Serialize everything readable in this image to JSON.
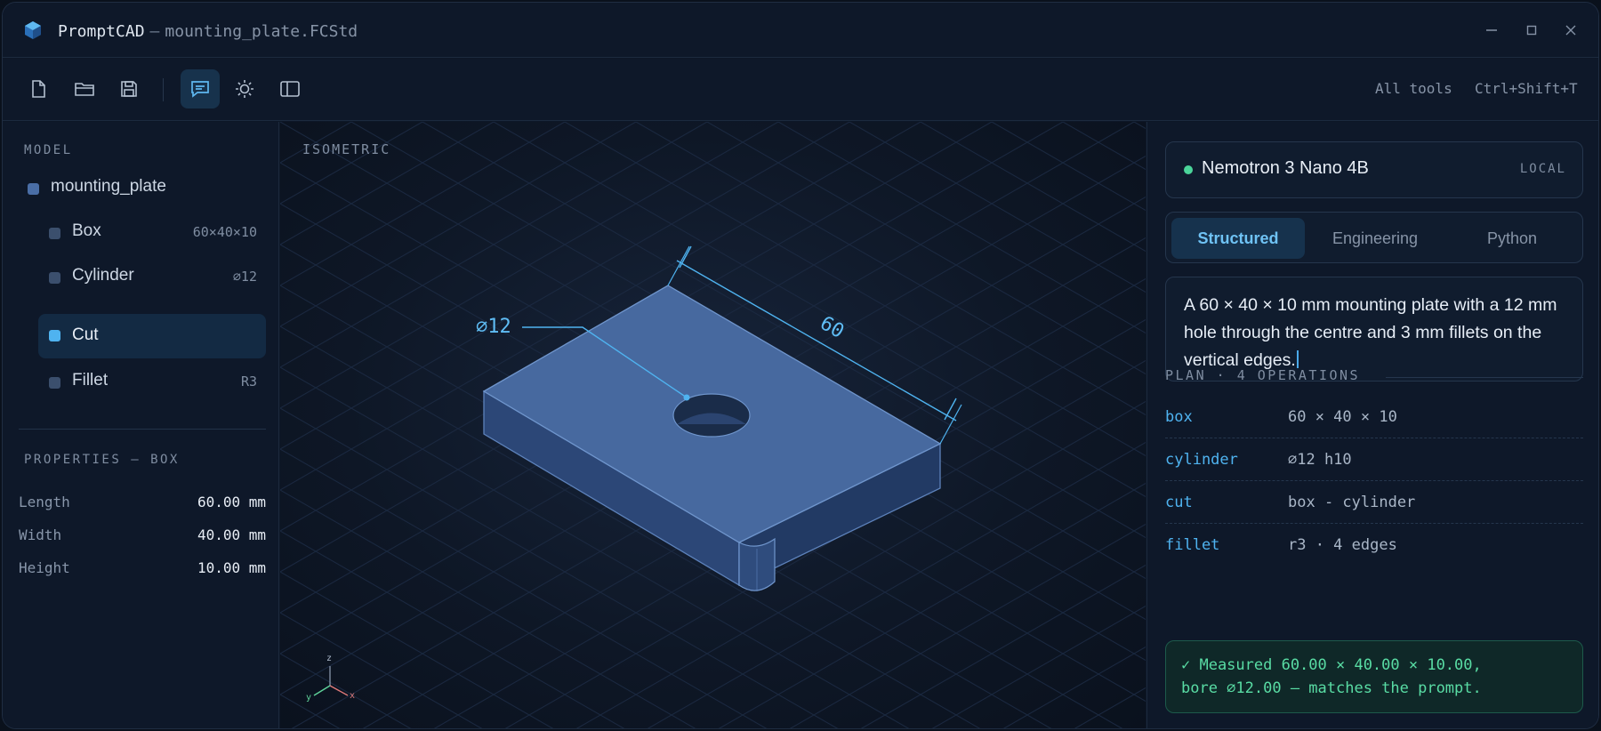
{
  "window": {
    "app_name": "PromptCAD",
    "separator": "—",
    "file_name": "mounting_plate.FCStd"
  },
  "toolbar": {
    "icons": [
      "new-file-icon",
      "open-folder-icon",
      "save-icon",
      "chat-icon",
      "sun-icon",
      "panel-icon"
    ],
    "active": "chat-icon",
    "all_tools_label": "All tools",
    "shortcut": "Ctrl+Shift+T"
  },
  "sidebar": {
    "model_label": "MODEL",
    "root": "mounting_plate",
    "items": [
      {
        "label": "Box",
        "dim": "60×40×10"
      },
      {
        "label": "Cylinder",
        "dim": "⌀12"
      },
      {
        "label": "Cut",
        "dim": ""
      },
      {
        "label": "Fillet",
        "dim": "R3"
      }
    ],
    "active_item": "Cut",
    "properties_label": "PROPERTIES — BOX",
    "properties": [
      {
        "key": "Length",
        "value": "60.00 mm"
      },
      {
        "key": "Width",
        "value": "40.00 mm"
      },
      {
        "key": "Height",
        "value": "10.00 mm"
      }
    ]
  },
  "viewport": {
    "view_label": "ISOMETRIC",
    "dim_diameter": "⌀12",
    "dim_length": "60",
    "axes": {
      "z": "z",
      "y": "y",
      "x": "x"
    }
  },
  "panel": {
    "model_name": "Nemotron 3 Nano 4B",
    "model_tag": "LOCAL",
    "tabs": [
      "Structured",
      "Engineering",
      "Python"
    ],
    "active_tab": "Structured",
    "prompt": "A 60 × 40 × 10 mm mounting plate with a 12 mm hole through the centre and 3 mm fillets on the vertical edges.",
    "plan_label": "PLAN · 4 OPERATIONS",
    "operations": [
      {
        "name": "box",
        "args": "60 × 40 × 10"
      },
      {
        "name": "cylinder",
        "args": "⌀12 h10"
      },
      {
        "name": "cut",
        "args": "box - cylinder"
      },
      {
        "name": "fillet",
        "args": "r3 · 4 edges"
      }
    ],
    "verify_line1": "✓ Measured 60.00 × 40.00 × 10.00,",
    "verify_line2": "bore ⌀12.00 — matches the prompt."
  },
  "colors": {
    "accent": "#4fb3f0",
    "success": "#59dca4",
    "status_dot": "#4bd49a",
    "plate_top": "#4a6ea6"
  }
}
